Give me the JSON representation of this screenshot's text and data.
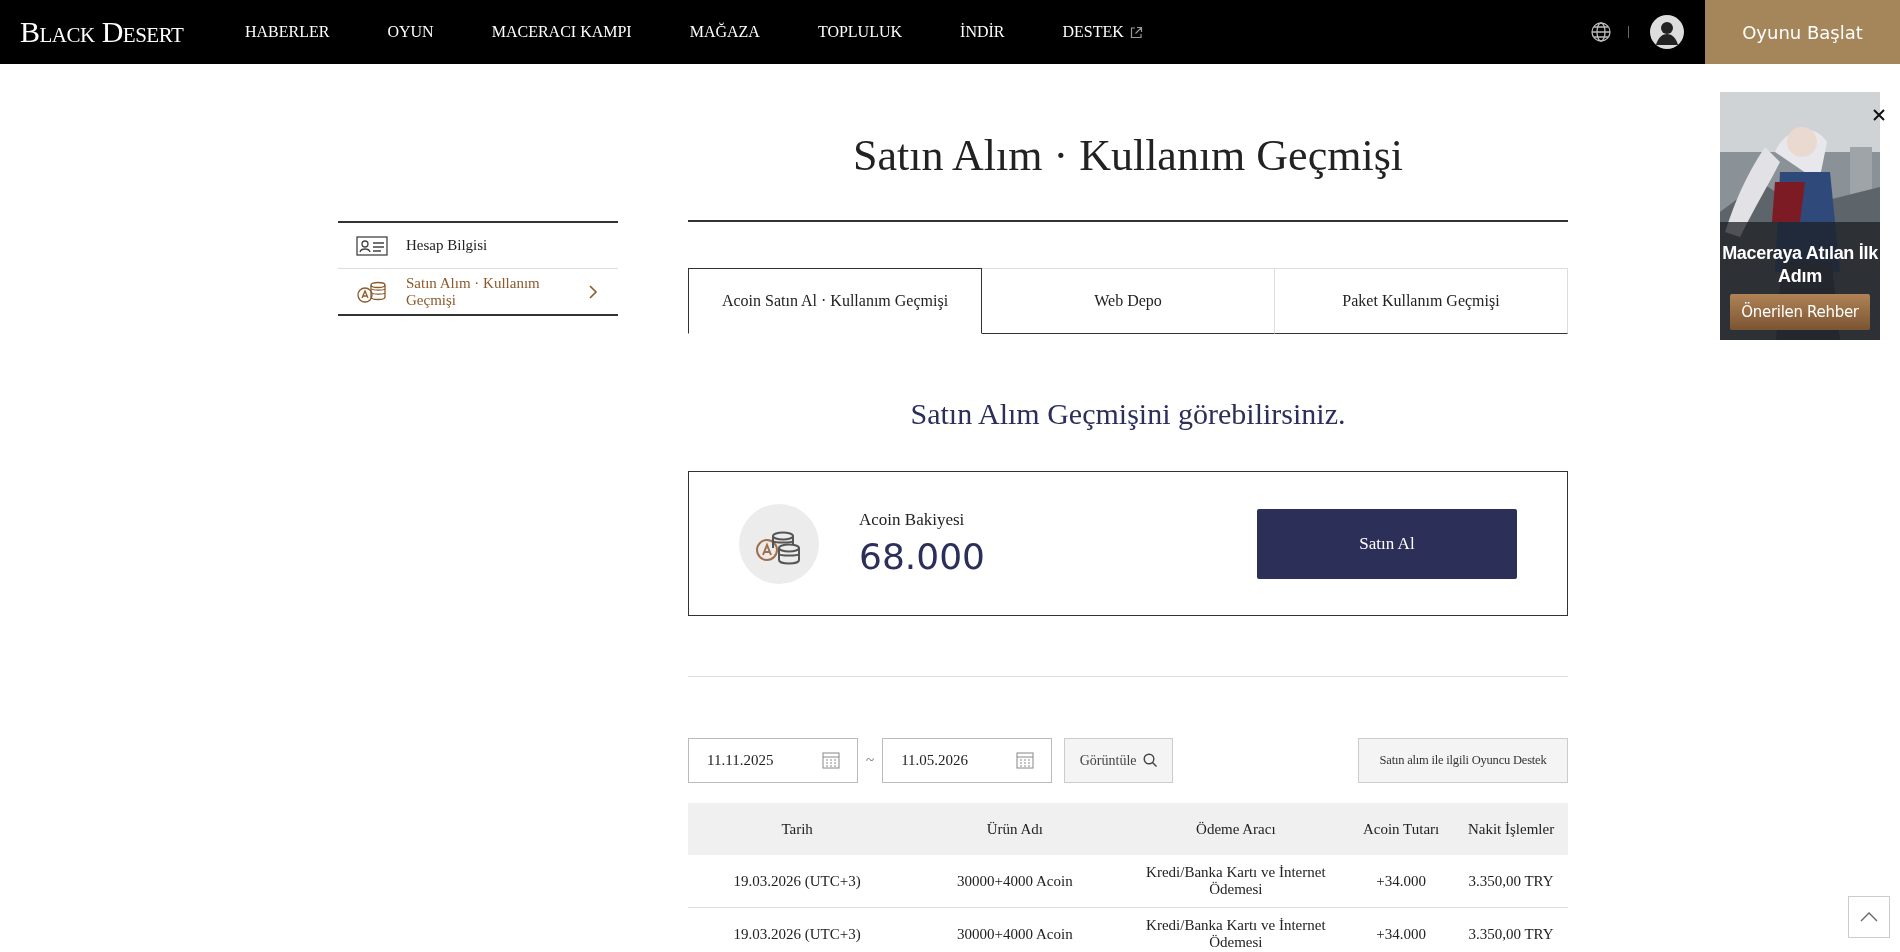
{
  "header": {
    "logo": "Black Desert",
    "nav": [
      {
        "label": "HABERLER",
        "external": false
      },
      {
        "label": "OYUN",
        "external": false
      },
      {
        "label": "MACERACI KAMPI",
        "external": false
      },
      {
        "label": "MAĞAZA",
        "external": false
      },
      {
        "label": "TOPLULUK",
        "external": false
      },
      {
        "label": "İNDİR",
        "external": false
      },
      {
        "label": "DESTEK",
        "external": true
      }
    ],
    "launch_button": "Oyunu Başlat"
  },
  "sidebar": {
    "items": [
      {
        "label": "Hesap Bilgisi",
        "selected": false
      },
      {
        "label": "Satın Alım · Kullanım Geçmişi",
        "selected": true
      }
    ]
  },
  "page": {
    "title": "Satın Alım · Kullanım Geçmişi",
    "tabs": [
      {
        "label": "Acoin Satın Al · Kullanım Geçmişi",
        "selected": true
      },
      {
        "label": "Web Depo",
        "selected": false
      },
      {
        "label": "Paket Kullanım Geçmişi",
        "selected": false
      }
    ],
    "subtitle": "Satın Alım Geçmişini görebilirsiniz.",
    "balance": {
      "label": "Acoin Bakiyesi",
      "amount": "68.000",
      "buy_button": "Satın Al"
    },
    "filter": {
      "start_date": "11.11.2025",
      "separator": "~",
      "end_date": "11.05.2026",
      "view_button": "Görüntüle",
      "support_button": "Satın alım ile ilgili Oyuncu Destek"
    },
    "table": {
      "columns": [
        "Tarih",
        "Ürün Adı",
        "Ödeme Aracı",
        "Acoin Tutarı",
        "Nakit İşlemler"
      ],
      "rows": [
        [
          "19.03.2026 (UTC+3)",
          "30000+4000 Acoin",
          "Kredi/Banka Kartı ve İnternet Ödemesi",
          "+34.000",
          "3.350,00 TRY"
        ],
        [
          "19.03.2026 (UTC+3)",
          "30000+4000 Acoin",
          "Kredi/Banka Kartı ve İnternet Ödemesi",
          "+34.000",
          "3.350,00 TRY"
        ]
      ]
    }
  },
  "promo": {
    "title": "Maceraya Atılan İlk Adım",
    "button": "Önerilen Rehber"
  }
}
